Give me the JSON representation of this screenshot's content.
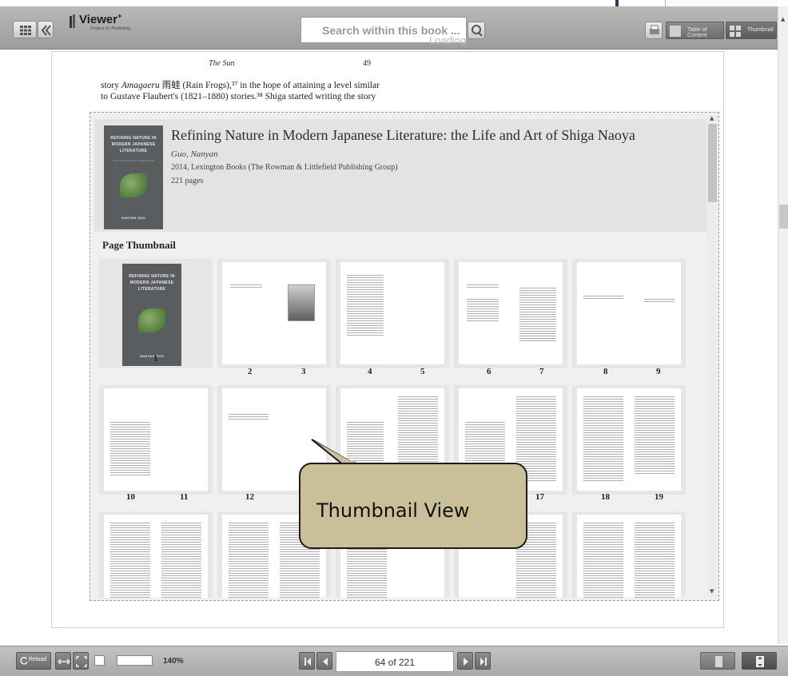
{
  "toolbar": {
    "logo_text": "Viewer",
    "logo_sup": "+",
    "logo_sub": "Product of i-Publishing",
    "search_placeholder": "Search within this book ...",
    "loading_text": "Loading",
    "toc_label": "Table of Content",
    "thumbnail_label": "Thumbnail",
    "icons": [
      "grid-icon",
      "double-chevron-left-icon",
      "search-icon",
      "print-icon",
      "toc-icon",
      "thumbnail-icon"
    ]
  },
  "book_page": {
    "running_head": "The Sun",
    "page_number": "49",
    "line1_pre": "story ",
    "line1_italic": "Amagaeru",
    "line1_post": " 雨蛙 (Rain Frogs),³⁷ in the hope of attaining a level similar",
    "line2": "to Gustave Flaubert's (1821–1880) stories.³⁸ Shiga started writing the story"
  },
  "book": {
    "title": "Refining Nature in Modern Japanese Literature: the Life and Art of Shiga Naoya",
    "author": "Guo, Nanyan",
    "publication": "2014,  Lexington Books (The Rowman & Littlefield Publishing Group)",
    "pages": "221 pages",
    "cover_title_1": "REFINING NATURE IN",
    "cover_title_2": "MODERN JAPANESE",
    "cover_title_3": "LITERATURE",
    "cover_subtitle": "The Life and Art of Shiga Naoya",
    "cover_author": "NANYAN GUO"
  },
  "thumbnails": {
    "section_title": "Page Thumbnail",
    "page_labels": [
      "1",
      "2",
      "3",
      "4",
      "5",
      "6",
      "7",
      "8",
      "9",
      "10",
      "11",
      "12",
      "17",
      "18",
      "19"
    ]
  },
  "callout": {
    "text": "Thumbnail View"
  },
  "bottom_bar": {
    "reload_label": "Reload",
    "zoom": "140%",
    "page_indicator": "64 of 221",
    "icons": [
      "fit-width-icon",
      "fullscreen-icon",
      "first-page-icon",
      "prev-page-icon",
      "next-page-icon",
      "last-page-icon",
      "single-page-icon",
      "scroll-mode-icon"
    ]
  }
}
